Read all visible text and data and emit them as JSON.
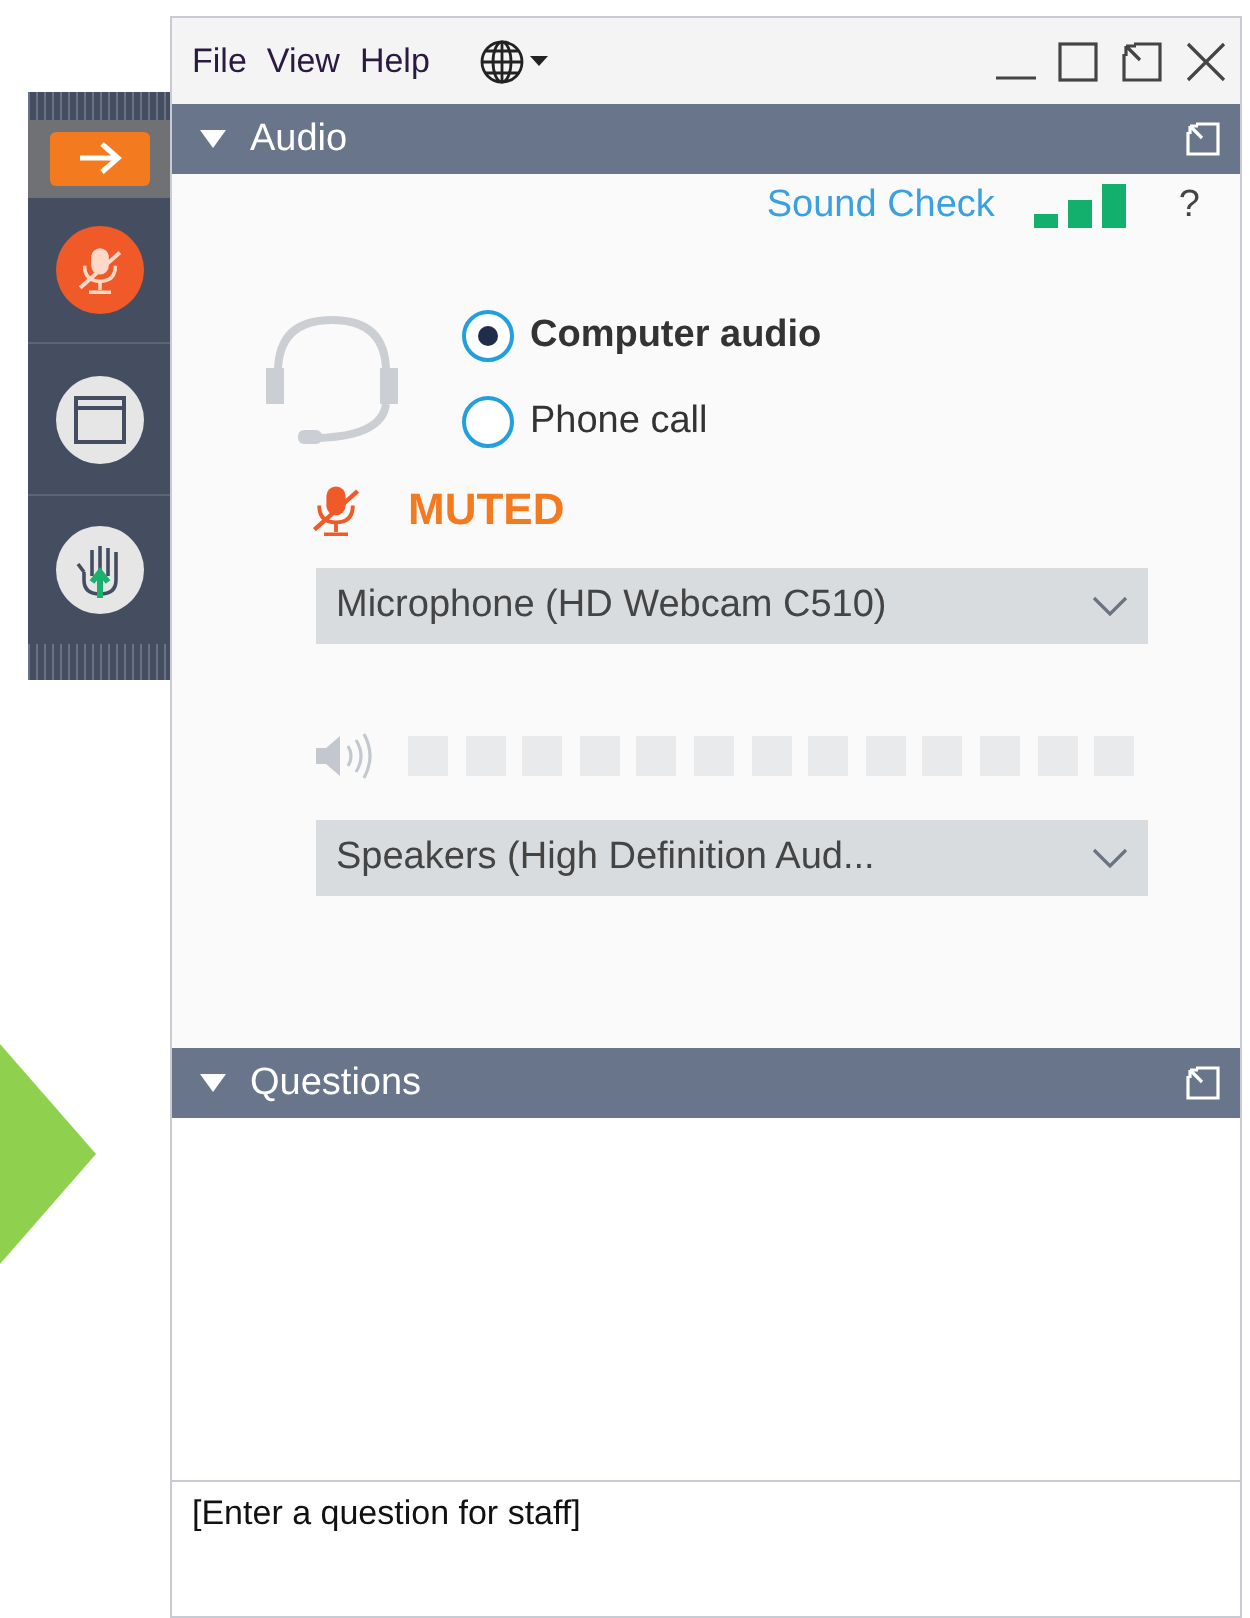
{
  "menu": [
    {
      "label": "File"
    },
    {
      "label": "View"
    },
    {
      "label": "Help"
    }
  ],
  "audio_panel": {
    "title": "Audio"
  },
  "sound_check": "Sound Check",
  "help": "?",
  "audio_modes": [
    {
      "label": "Computer audio",
      "selected": true
    },
    {
      "label": "Phone call",
      "selected": false
    }
  ],
  "mute_status": {
    "label": "MUTED",
    "muted": true
  },
  "microphone": {
    "value": "Microphone (HD Webcam C510)"
  },
  "speakers": {
    "value": "Speakers (High Definition Aud..."
  },
  "questions_panel": {
    "title": "Questions"
  },
  "question_input": {
    "placeholder": "[Enter a question for staff]"
  }
}
